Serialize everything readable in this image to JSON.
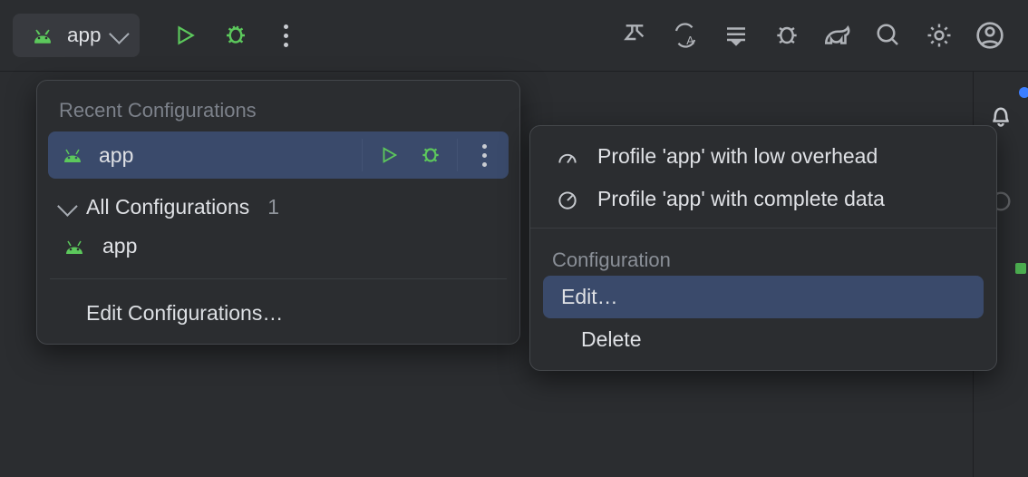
{
  "toolbar": {
    "config_selector_label": "app"
  },
  "popup": {
    "recent_title": "Recent Configurations",
    "selected_config": "app",
    "all_configs_label": "All Configurations",
    "all_configs_count": "1",
    "app_item": "app",
    "edit_configs": "Edit Configurations…"
  },
  "context": {
    "profile_low": "Profile 'app' with low overhead",
    "profile_complete": "Profile 'app' with complete data",
    "config_section": "Configuration",
    "edit": "Edit…",
    "delete": "Delete"
  }
}
